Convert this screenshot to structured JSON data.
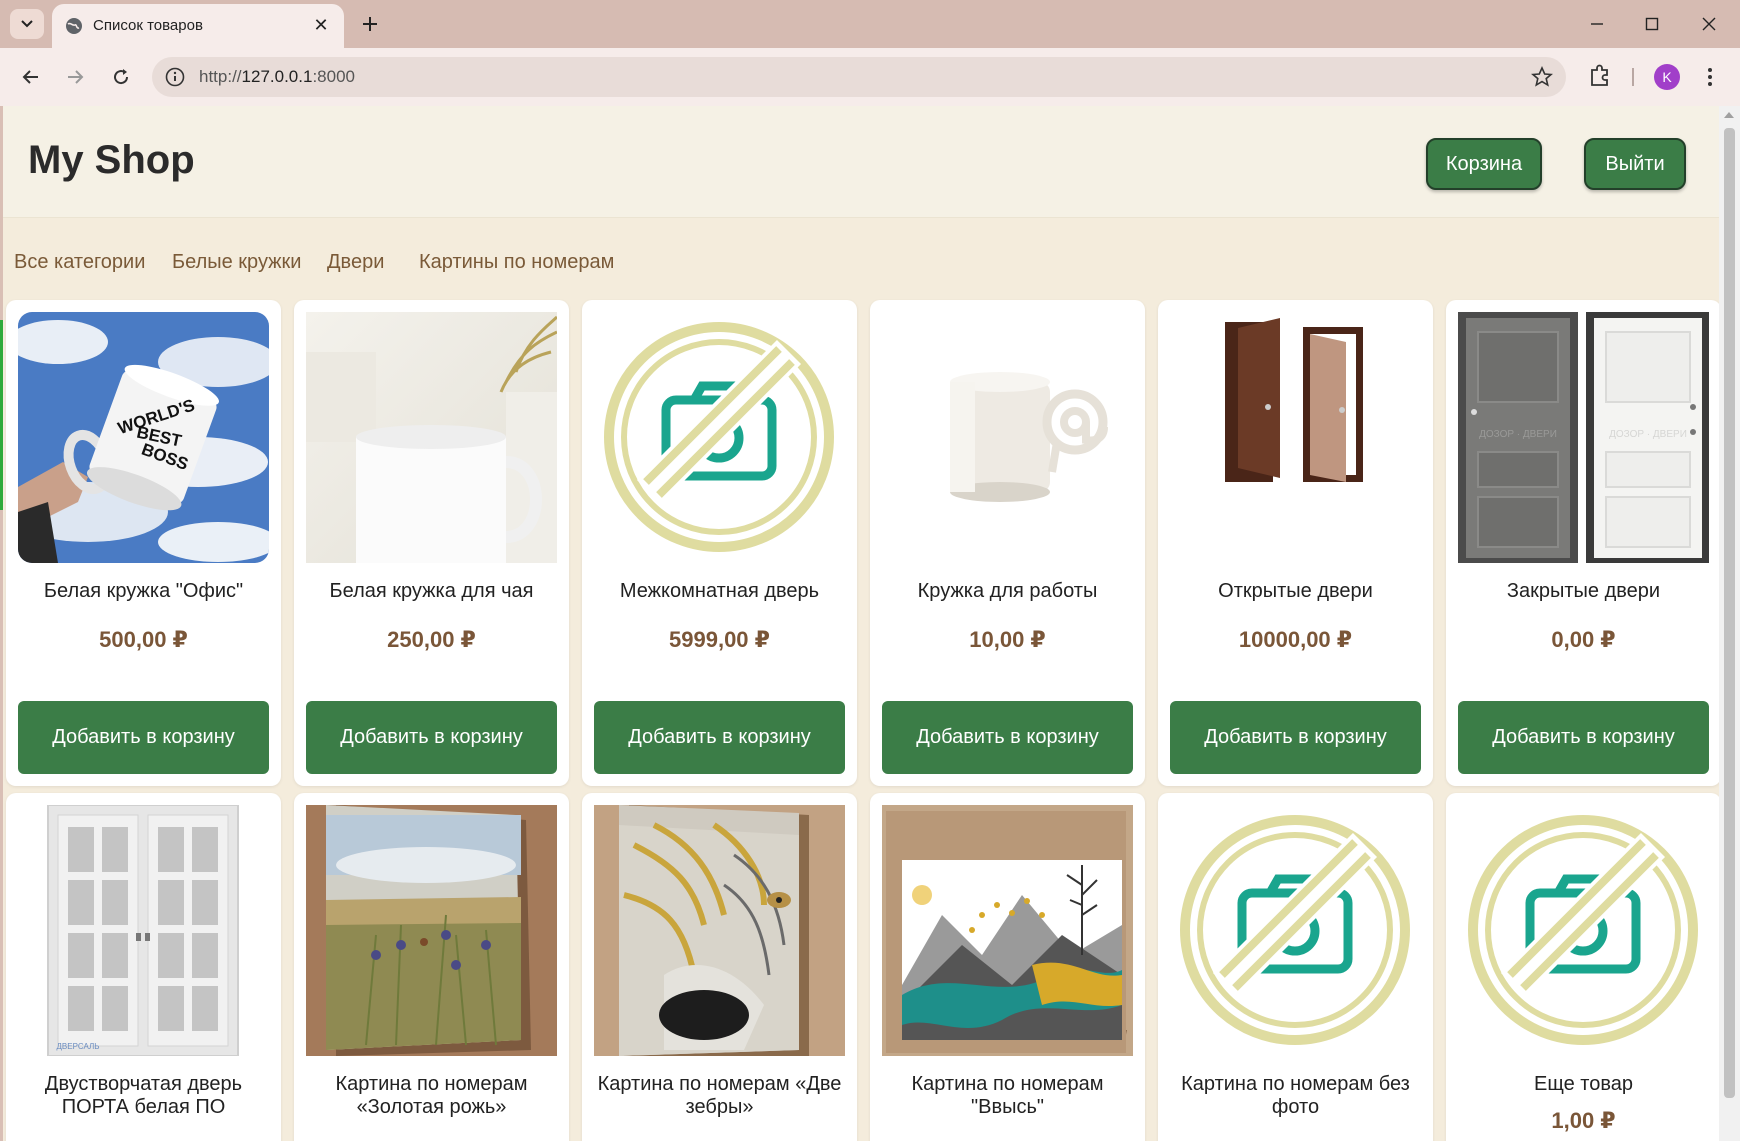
{
  "browser": {
    "tab_title": "Список товаров",
    "url_prefix": "http://",
    "url_host": "127.0.0.1",
    "url_port": ":8000",
    "avatar_letter": "K",
    "icons": [
      "chevron-down-icon",
      "globe-icon",
      "close-icon",
      "plus-icon",
      "minimize-icon",
      "maximize-icon",
      "close-window-icon",
      "back-icon",
      "forward-icon",
      "reload-icon",
      "info-icon",
      "star-icon",
      "extensions-icon",
      "kebab-menu-icon"
    ]
  },
  "header": {
    "brand": "My Shop",
    "cart_label": "Корзина",
    "logout_label": "Выйти"
  },
  "categories": [
    "Все категории",
    "Белые кружки",
    "Двери",
    "Картины по номерам"
  ],
  "products": [
    {
      "name": "Белая кружка \"Офис\"",
      "price": "500,00 ₽",
      "button": "Добавить в корзину",
      "image": "boss-mug"
    },
    {
      "name": "Белая кружка для чая",
      "price": "250,00 ₽",
      "button": "Добавить в корзину",
      "image": "tea-mug"
    },
    {
      "name": "Межкомнатная дверь",
      "price": "5999,00 ₽",
      "button": "Добавить в корзину",
      "image": "no-photo"
    },
    {
      "name": "Кружка для работы",
      "price": "10,00 ₽",
      "button": "Добавить в корзину",
      "image": "at-mug"
    },
    {
      "name": "Открытые двери",
      "price": "10000,00 ₽",
      "button": "Добавить в корзину",
      "image": "open-doors"
    },
    {
      "name": "Закрытые двери",
      "price": "0,00 ₽",
      "button": "Добавить в корзину",
      "image": "closed-doors"
    },
    {
      "name": "Двустворчатая дверь ПОРТА белая ПО",
      "price": "",
      "button": "",
      "image": "double-door"
    },
    {
      "name": "Картина по номерам «Золотая рожь»",
      "price": "",
      "button": "",
      "image": "painting-rye"
    },
    {
      "name": "Картина по номерам «Две зебры»",
      "price": "",
      "button": "",
      "image": "painting-zebra"
    },
    {
      "name": "Картина по номерам \"Ввысь\"",
      "price": "",
      "button": "",
      "image": "painting-up"
    },
    {
      "name": "Картина по номерам без фото",
      "price": "",
      "button": "",
      "image": "no-photo"
    },
    {
      "name": "Еще товар",
      "price": "1,00 ₽",
      "button": "",
      "image": "no-photo"
    }
  ],
  "image_texts": {
    "boss_mug": [
      "WORLD'S",
      "BEST",
      "BOSS"
    ],
    "door_watermark": "ДОЗОР · ДВЕРИ",
    "double_door_brand": "ДВЕРСАЛЬ"
  },
  "colors": {
    "accent_green": "#3b7d47",
    "price_brown": "#7a5638",
    "category_brown": "#7a5a38",
    "no_photo_ring": "#dedca0",
    "no_photo_camera": "#1da58f"
  }
}
